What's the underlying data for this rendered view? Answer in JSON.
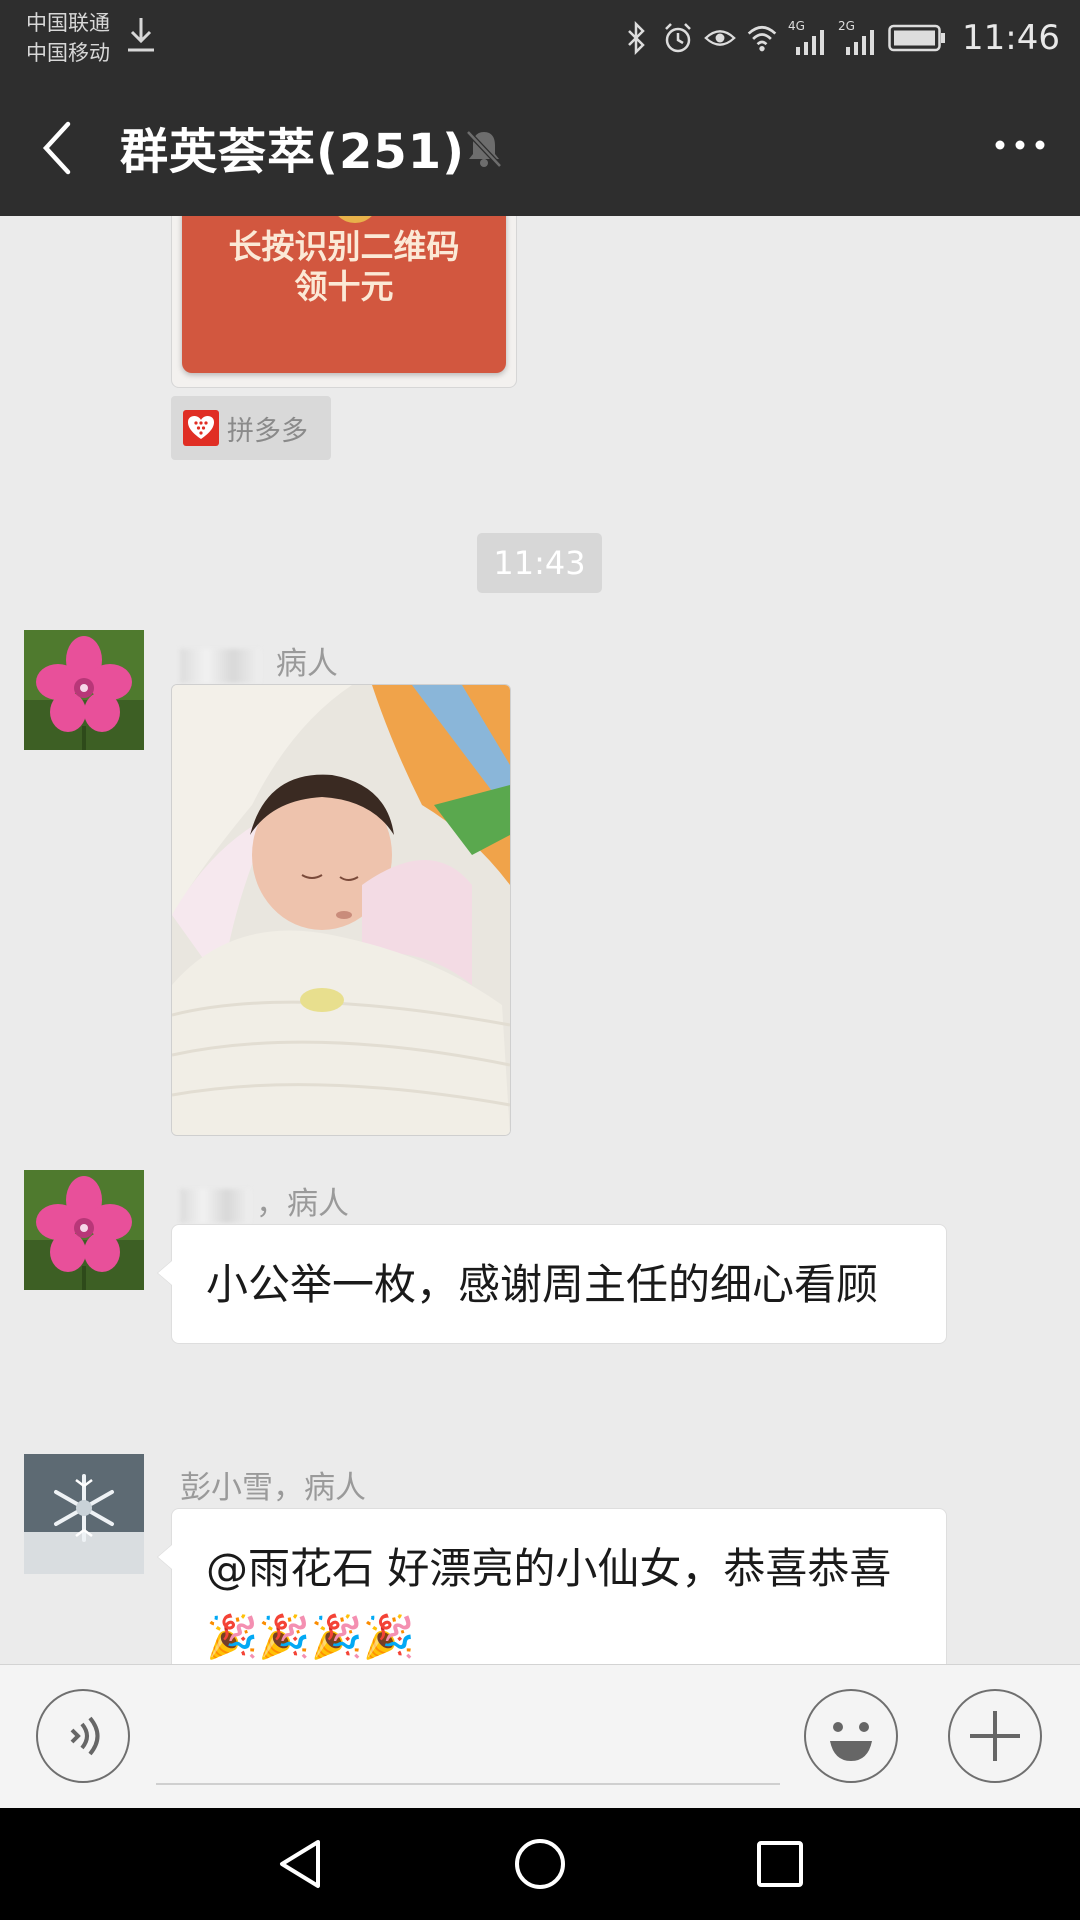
{
  "status_bar": {
    "carrier_1": "中国联通",
    "carrier_2": "中国移动",
    "network_1": "4G",
    "network_2": "2G",
    "time": "11:46"
  },
  "title_bar": {
    "title": "群英荟萃(251)"
  },
  "messages": {
    "red_packet_card": {
      "line1": "长按识别二维码",
      "line2": "领十元"
    },
    "app_source": {
      "name": "拼多多",
      "brand_color": "#e02e24"
    },
    "timestamp": "11:43",
    "photo_message": {
      "sender_suffix": "病人"
    },
    "text_message_1": {
      "sender_suffix": "，病人",
      "text": "小公举一枚，感谢周主任的细心看顾"
    },
    "text_message_2": {
      "sender": "彭小雪，病人",
      "text": "@雨花石  好漂亮的小仙女，恭喜恭喜🎉🎉🎉🎉"
    }
  },
  "colors": {
    "header_bg": "#2e2e2e",
    "chat_bg": "#ebebeb",
    "bubble_bg": "#ffffff"
  }
}
